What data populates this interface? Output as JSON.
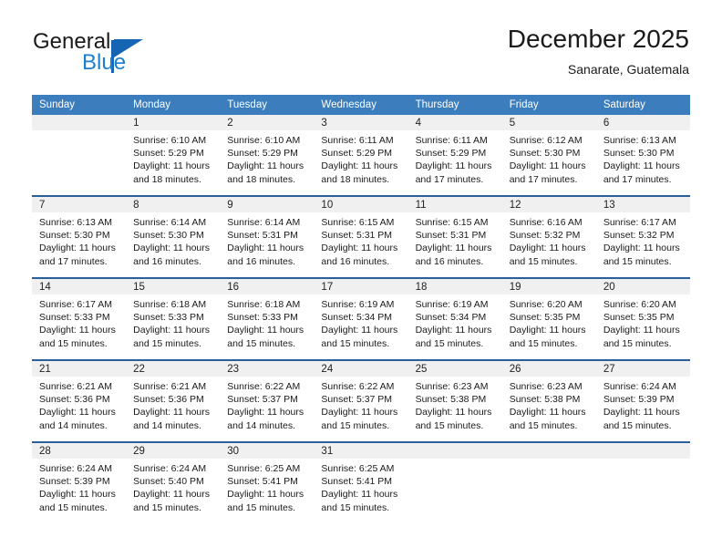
{
  "brand": {
    "name_part1": "General",
    "name_part2": "Blue"
  },
  "header": {
    "title": "December 2025",
    "subtitle": "Sanarate, Guatemala"
  },
  "colors": {
    "header_blue": "#3c7ebd",
    "row_divider": "#2a6099",
    "daynum_band": "#f0f0f0",
    "brand_blue": "#1c7fd0"
  },
  "weekday_headers": [
    "Sunday",
    "Monday",
    "Tuesday",
    "Wednesday",
    "Thursday",
    "Friday",
    "Saturday"
  ],
  "labels": {
    "sunrise_prefix": "Sunrise:",
    "sunset_prefix": "Sunset:",
    "daylight_prefix": "Daylight:"
  },
  "weeks": [
    [
      {
        "day": "",
        "sunrise": "",
        "sunset": "",
        "daylight_line1": "",
        "daylight_line2": ""
      },
      {
        "day": "1",
        "sunrise": "Sunrise: 6:10 AM",
        "sunset": "Sunset: 5:29 PM",
        "daylight_line1": "Daylight: 11 hours",
        "daylight_line2": "and 18 minutes."
      },
      {
        "day": "2",
        "sunrise": "Sunrise: 6:10 AM",
        "sunset": "Sunset: 5:29 PM",
        "daylight_line1": "Daylight: 11 hours",
        "daylight_line2": "and 18 minutes."
      },
      {
        "day": "3",
        "sunrise": "Sunrise: 6:11 AM",
        "sunset": "Sunset: 5:29 PM",
        "daylight_line1": "Daylight: 11 hours",
        "daylight_line2": "and 18 minutes."
      },
      {
        "day": "4",
        "sunrise": "Sunrise: 6:11 AM",
        "sunset": "Sunset: 5:29 PM",
        "daylight_line1": "Daylight: 11 hours",
        "daylight_line2": "and 17 minutes."
      },
      {
        "day": "5",
        "sunrise": "Sunrise: 6:12 AM",
        "sunset": "Sunset: 5:30 PM",
        "daylight_line1": "Daylight: 11 hours",
        "daylight_line2": "and 17 minutes."
      },
      {
        "day": "6",
        "sunrise": "Sunrise: 6:13 AM",
        "sunset": "Sunset: 5:30 PM",
        "daylight_line1": "Daylight: 11 hours",
        "daylight_line2": "and 17 minutes."
      }
    ],
    [
      {
        "day": "7",
        "sunrise": "Sunrise: 6:13 AM",
        "sunset": "Sunset: 5:30 PM",
        "daylight_line1": "Daylight: 11 hours",
        "daylight_line2": "and 17 minutes."
      },
      {
        "day": "8",
        "sunrise": "Sunrise: 6:14 AM",
        "sunset": "Sunset: 5:30 PM",
        "daylight_line1": "Daylight: 11 hours",
        "daylight_line2": "and 16 minutes."
      },
      {
        "day": "9",
        "sunrise": "Sunrise: 6:14 AM",
        "sunset": "Sunset: 5:31 PM",
        "daylight_line1": "Daylight: 11 hours",
        "daylight_line2": "and 16 minutes."
      },
      {
        "day": "10",
        "sunrise": "Sunrise: 6:15 AM",
        "sunset": "Sunset: 5:31 PM",
        "daylight_line1": "Daylight: 11 hours",
        "daylight_line2": "and 16 minutes."
      },
      {
        "day": "11",
        "sunrise": "Sunrise: 6:15 AM",
        "sunset": "Sunset: 5:31 PM",
        "daylight_line1": "Daylight: 11 hours",
        "daylight_line2": "and 16 minutes."
      },
      {
        "day": "12",
        "sunrise": "Sunrise: 6:16 AM",
        "sunset": "Sunset: 5:32 PM",
        "daylight_line1": "Daylight: 11 hours",
        "daylight_line2": "and 15 minutes."
      },
      {
        "day": "13",
        "sunrise": "Sunrise: 6:17 AM",
        "sunset": "Sunset: 5:32 PM",
        "daylight_line1": "Daylight: 11 hours",
        "daylight_line2": "and 15 minutes."
      }
    ],
    [
      {
        "day": "14",
        "sunrise": "Sunrise: 6:17 AM",
        "sunset": "Sunset: 5:33 PM",
        "daylight_line1": "Daylight: 11 hours",
        "daylight_line2": "and 15 minutes."
      },
      {
        "day": "15",
        "sunrise": "Sunrise: 6:18 AM",
        "sunset": "Sunset: 5:33 PM",
        "daylight_line1": "Daylight: 11 hours",
        "daylight_line2": "and 15 minutes."
      },
      {
        "day": "16",
        "sunrise": "Sunrise: 6:18 AM",
        "sunset": "Sunset: 5:33 PM",
        "daylight_line1": "Daylight: 11 hours",
        "daylight_line2": "and 15 minutes."
      },
      {
        "day": "17",
        "sunrise": "Sunrise: 6:19 AM",
        "sunset": "Sunset: 5:34 PM",
        "daylight_line1": "Daylight: 11 hours",
        "daylight_line2": "and 15 minutes."
      },
      {
        "day": "18",
        "sunrise": "Sunrise: 6:19 AM",
        "sunset": "Sunset: 5:34 PM",
        "daylight_line1": "Daylight: 11 hours",
        "daylight_line2": "and 15 minutes."
      },
      {
        "day": "19",
        "sunrise": "Sunrise: 6:20 AM",
        "sunset": "Sunset: 5:35 PM",
        "daylight_line1": "Daylight: 11 hours",
        "daylight_line2": "and 15 minutes."
      },
      {
        "day": "20",
        "sunrise": "Sunrise: 6:20 AM",
        "sunset": "Sunset: 5:35 PM",
        "daylight_line1": "Daylight: 11 hours",
        "daylight_line2": "and 15 minutes."
      }
    ],
    [
      {
        "day": "21",
        "sunrise": "Sunrise: 6:21 AM",
        "sunset": "Sunset: 5:36 PM",
        "daylight_line1": "Daylight: 11 hours",
        "daylight_line2": "and 14 minutes."
      },
      {
        "day": "22",
        "sunrise": "Sunrise: 6:21 AM",
        "sunset": "Sunset: 5:36 PM",
        "daylight_line1": "Daylight: 11 hours",
        "daylight_line2": "and 14 minutes."
      },
      {
        "day": "23",
        "sunrise": "Sunrise: 6:22 AM",
        "sunset": "Sunset: 5:37 PM",
        "daylight_line1": "Daylight: 11 hours",
        "daylight_line2": "and 14 minutes."
      },
      {
        "day": "24",
        "sunrise": "Sunrise: 6:22 AM",
        "sunset": "Sunset: 5:37 PM",
        "daylight_line1": "Daylight: 11 hours",
        "daylight_line2": "and 15 minutes."
      },
      {
        "day": "25",
        "sunrise": "Sunrise: 6:23 AM",
        "sunset": "Sunset: 5:38 PM",
        "daylight_line1": "Daylight: 11 hours",
        "daylight_line2": "and 15 minutes."
      },
      {
        "day": "26",
        "sunrise": "Sunrise: 6:23 AM",
        "sunset": "Sunset: 5:38 PM",
        "daylight_line1": "Daylight: 11 hours",
        "daylight_line2": "and 15 minutes."
      },
      {
        "day": "27",
        "sunrise": "Sunrise: 6:24 AM",
        "sunset": "Sunset: 5:39 PM",
        "daylight_line1": "Daylight: 11 hours",
        "daylight_line2": "and 15 minutes."
      }
    ],
    [
      {
        "day": "28",
        "sunrise": "Sunrise: 6:24 AM",
        "sunset": "Sunset: 5:39 PM",
        "daylight_line1": "Daylight: 11 hours",
        "daylight_line2": "and 15 minutes."
      },
      {
        "day": "29",
        "sunrise": "Sunrise: 6:24 AM",
        "sunset": "Sunset: 5:40 PM",
        "daylight_line1": "Daylight: 11 hours",
        "daylight_line2": "and 15 minutes."
      },
      {
        "day": "30",
        "sunrise": "Sunrise: 6:25 AM",
        "sunset": "Sunset: 5:41 PM",
        "daylight_line1": "Daylight: 11 hours",
        "daylight_line2": "and 15 minutes."
      },
      {
        "day": "31",
        "sunrise": "Sunrise: 6:25 AM",
        "sunset": "Sunset: 5:41 PM",
        "daylight_line1": "Daylight: 11 hours",
        "daylight_line2": "and 15 minutes."
      },
      {
        "day": "",
        "sunrise": "",
        "sunset": "",
        "daylight_line1": "",
        "daylight_line2": ""
      },
      {
        "day": "",
        "sunrise": "",
        "sunset": "",
        "daylight_line1": "",
        "daylight_line2": ""
      },
      {
        "day": "",
        "sunrise": "",
        "sunset": "",
        "daylight_line1": "",
        "daylight_line2": ""
      }
    ]
  ]
}
